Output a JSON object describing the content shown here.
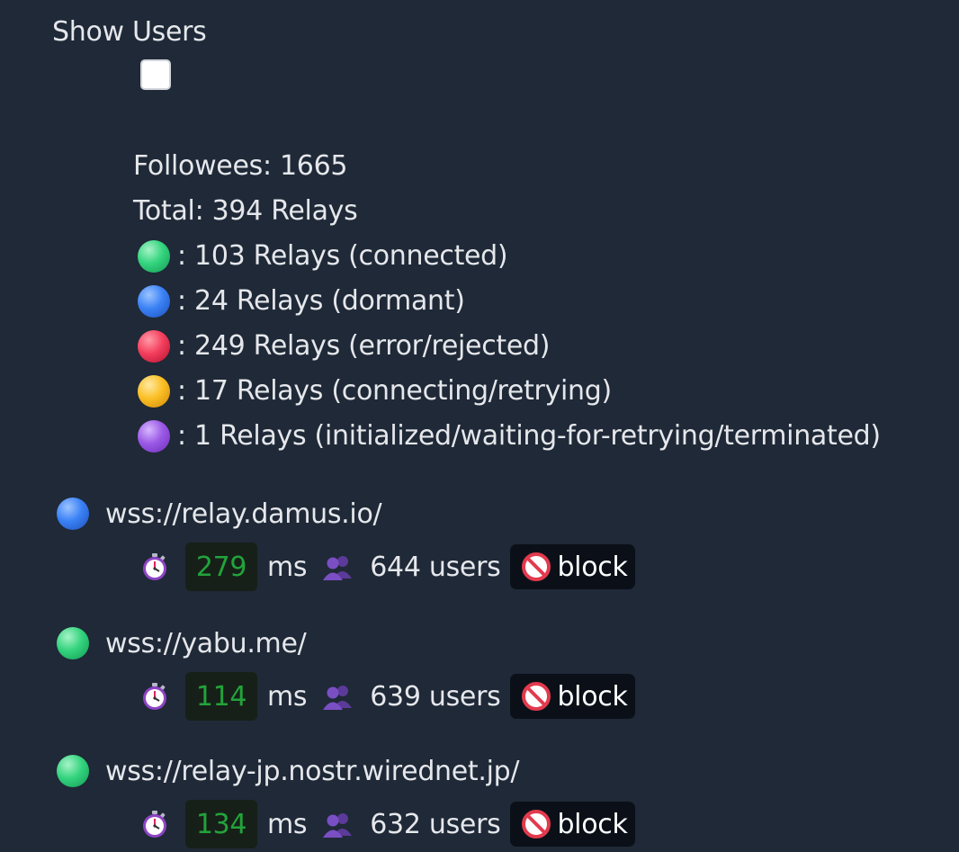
{
  "show_users": {
    "label": "Show Users",
    "checked": false
  },
  "stats": {
    "followees": "Followees: 1665",
    "total": "Total: 394 Relays",
    "statuses": [
      {
        "color": "green",
        "text": ": 103 Relays (connected)"
      },
      {
        "color": "blue",
        "text": ": 24 Relays (dormant)"
      },
      {
        "color": "red",
        "text": ": 249 Relays (error/rejected)"
      },
      {
        "color": "yellow",
        "text": ": 17 Relays (connecting/retrying)"
      },
      {
        "color": "purple",
        "text": ": 1 Relays (initialized/waiting-for-retrying/terminated)"
      }
    ]
  },
  "relays": [
    {
      "status": "blue",
      "url": "wss://relay.damus.io/",
      "ping": "279",
      "ms_label": "ms",
      "users": "644 users",
      "block_label": "block"
    },
    {
      "status": "green",
      "url": "wss://yabu.me/",
      "ping": "114",
      "ms_label": "ms",
      "users": "639 users",
      "block_label": "block"
    },
    {
      "status": "green",
      "url": "wss://relay-jp.nostr.wirednet.jp/",
      "ping": "134",
      "ms_label": "ms",
      "users": "632 users",
      "block_label": "block"
    }
  ],
  "icons": {
    "status_orb": "circle-icon",
    "latency": "stopwatch-icon",
    "users": "users-icon",
    "block": "prohibited-icon"
  },
  "colors": {
    "background": "#1f2937",
    "ping_text": "#22a33a",
    "green": "#34d47e",
    "blue": "#3b82f6",
    "red": "#f43f5e",
    "yellow": "#fbbf24",
    "purple": "#9b59e6"
  }
}
